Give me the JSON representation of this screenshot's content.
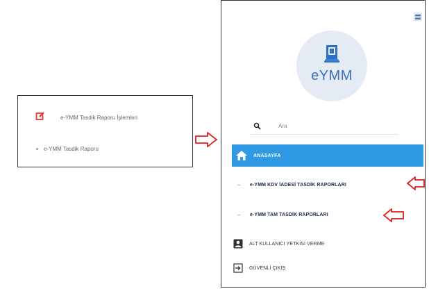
{
  "left_panel": {
    "item1_label": "e-YMM Tasdik Raporu İşlemleri",
    "item2_label": "e-YMM Tasdik Raporu"
  },
  "sidebar": {
    "logo_text": "eYMM",
    "search_placeholder": "Ara",
    "home_label": "ANASAYFA",
    "items": [
      {
        "label": "e-YMM KDV İADESİ TASDİK RAPORLARI"
      },
      {
        "label": "e-YMM TAM TASDİK RAPORLARI"
      },
      {
        "label": "ALT KULLANICI YETKİSİ VERME"
      },
      {
        "label": "GÜVENLİ ÇIKIŞ"
      }
    ]
  },
  "colors": {
    "accent": "#2f9ae3",
    "arrow": "#e02020",
    "edit_icon": "#e53935"
  },
  "icons": [
    "edit-icon",
    "search-icon",
    "home-icon",
    "user-icon",
    "logout-icon",
    "menu-icon",
    "document-icon",
    "arrow-icon"
  ]
}
